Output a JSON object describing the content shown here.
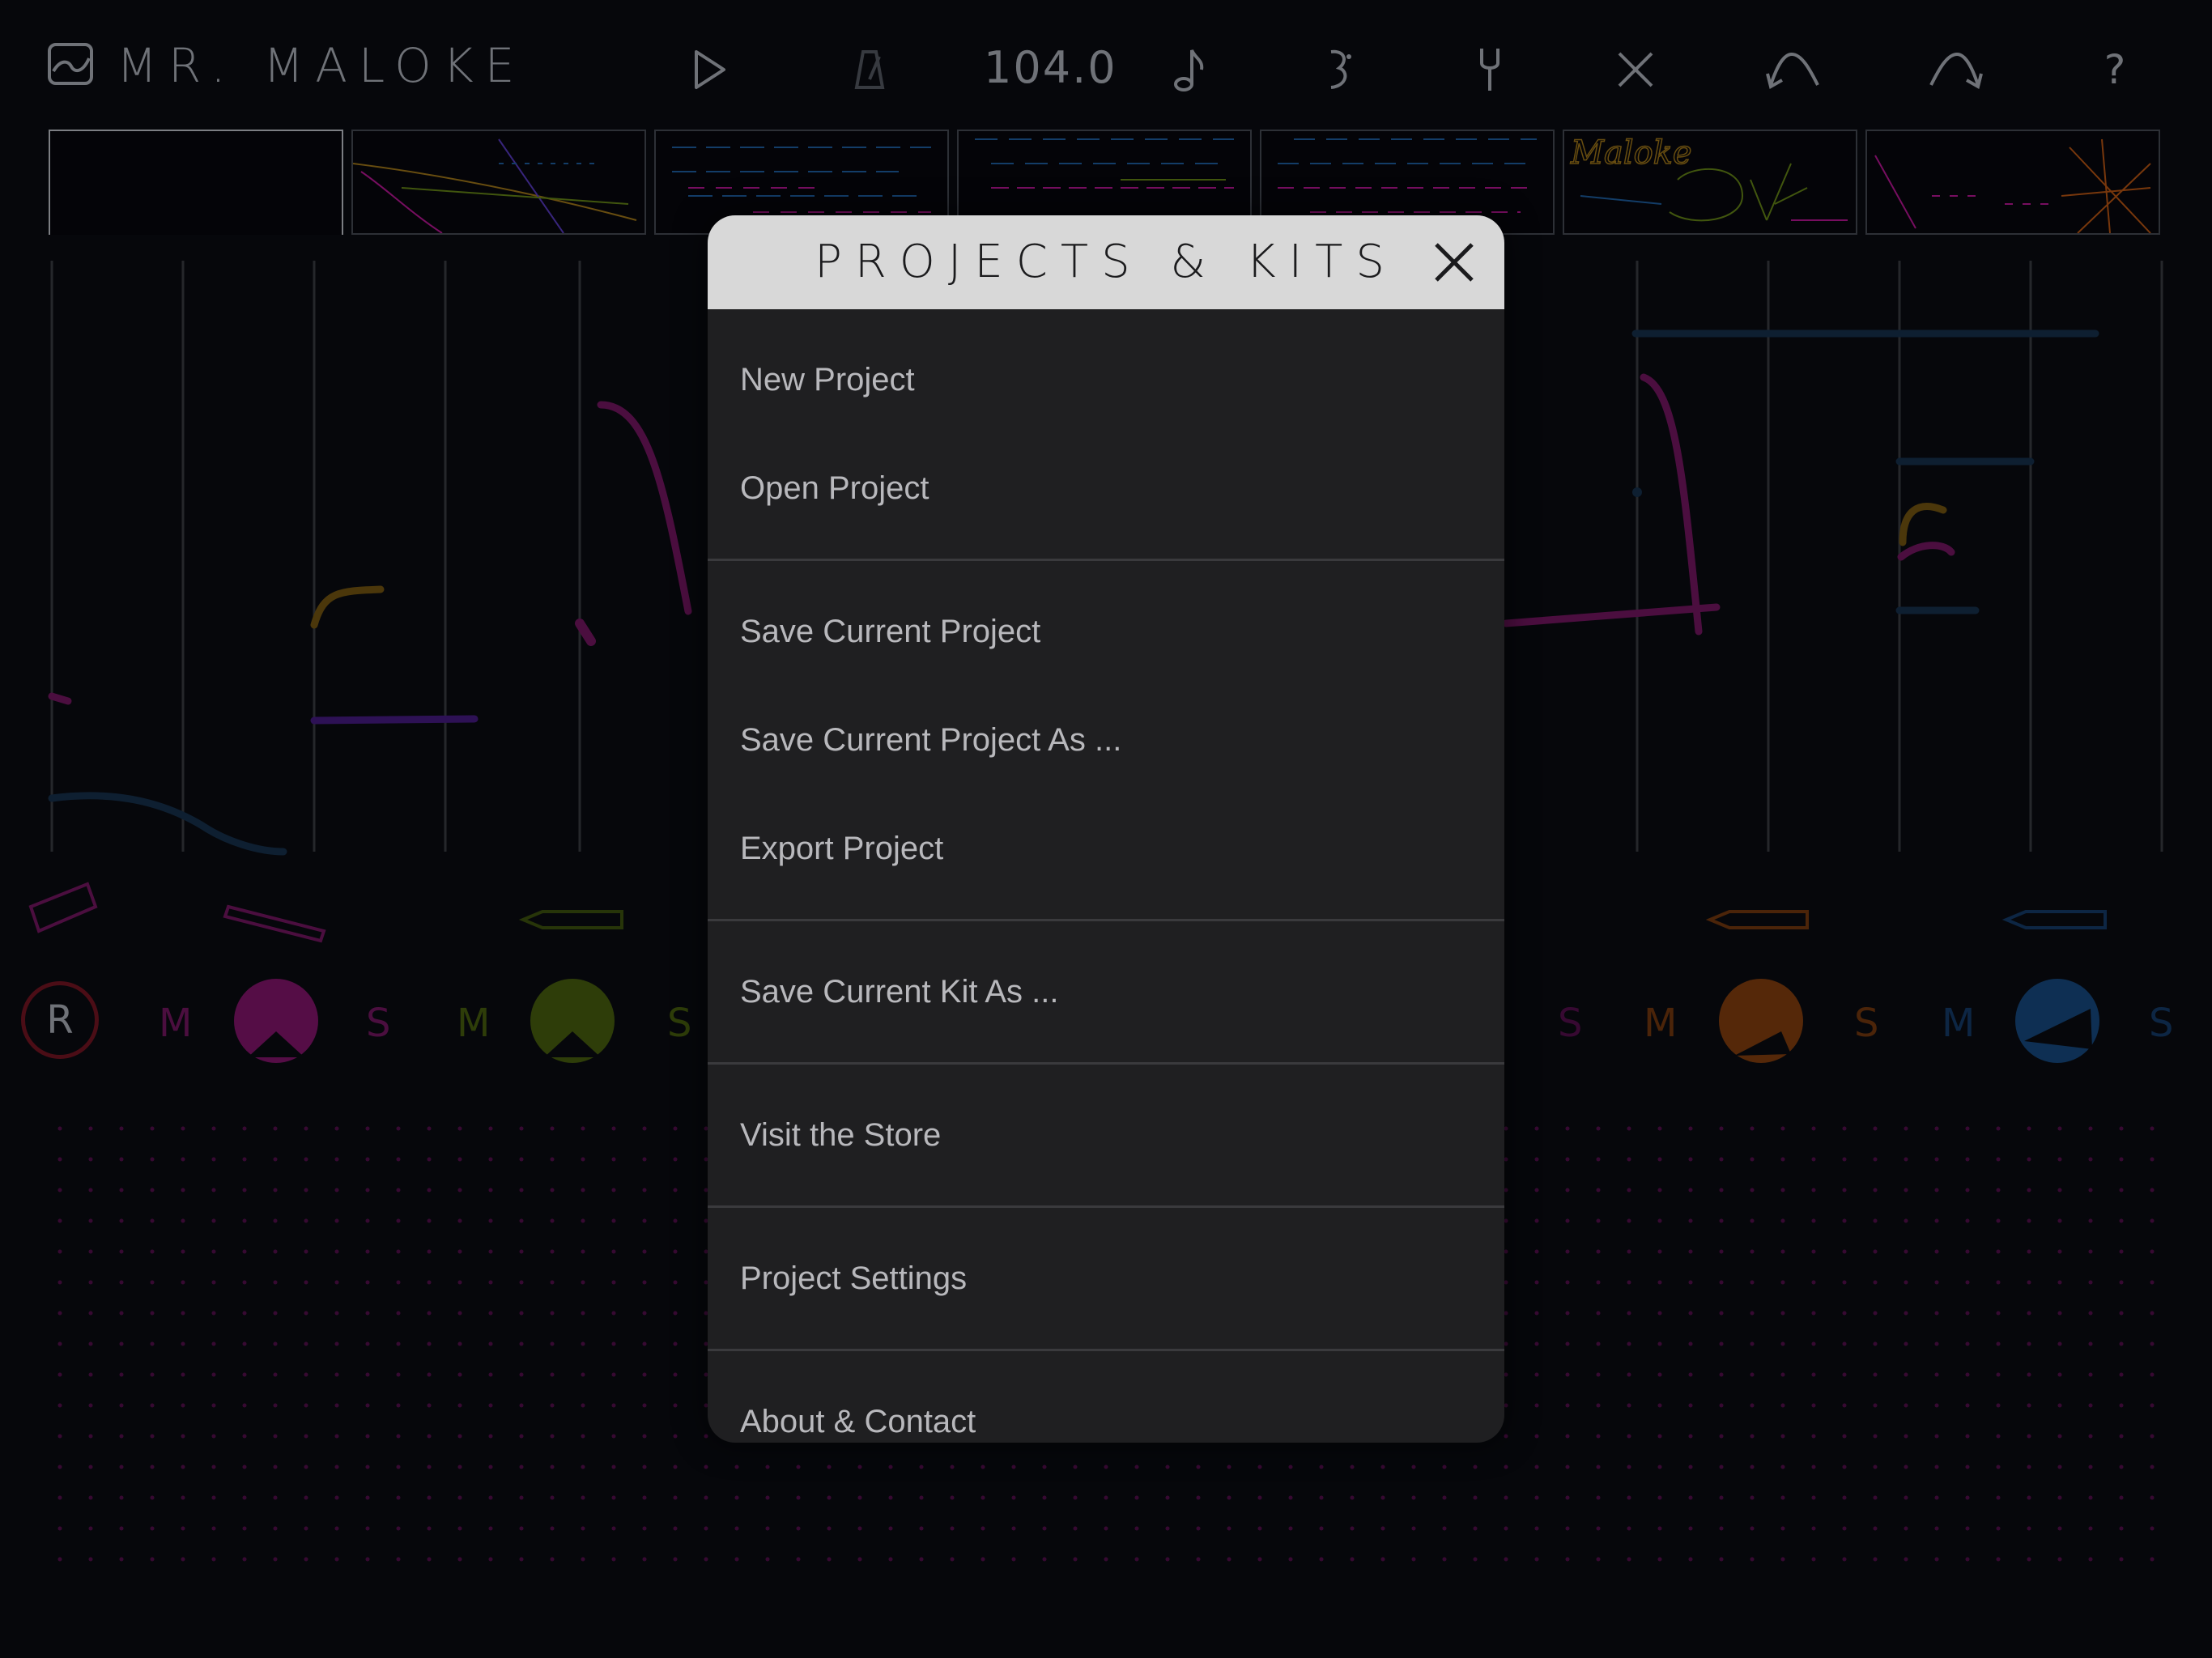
{
  "app": {
    "title": "MR. MALOKE",
    "tempo": "104.0",
    "help_label": "?"
  },
  "toolbar": {
    "icons": [
      "play-icon",
      "metronome-icon",
      "note-icon",
      "loop-icon",
      "tuning-fork-icon",
      "close-icon",
      "undo-icon",
      "redo-icon"
    ]
  },
  "scene_thumbs": {
    "logo_text": "Maloke"
  },
  "tracks": {
    "record_label": "R",
    "mute_label": "M",
    "solo_label": "S",
    "colors": [
      "#c0179c",
      "#6a8b18",
      "#c25a14",
      "#1f63a8"
    ]
  },
  "dialog": {
    "title": "PROJECTS & KITS",
    "groups": [
      {
        "items": [
          "New Project",
          "Open Project"
        ]
      },
      {
        "items": [
          "Save Current Project",
          "Save Current Project As ...",
          "Export Project"
        ]
      },
      {
        "items": [
          "Save Current Kit As ..."
        ]
      },
      {
        "items": [
          "Visit the Store"
        ]
      },
      {
        "items": [
          "Project Settings"
        ]
      },
      {
        "items": [
          "About & Contact"
        ]
      }
    ]
  }
}
